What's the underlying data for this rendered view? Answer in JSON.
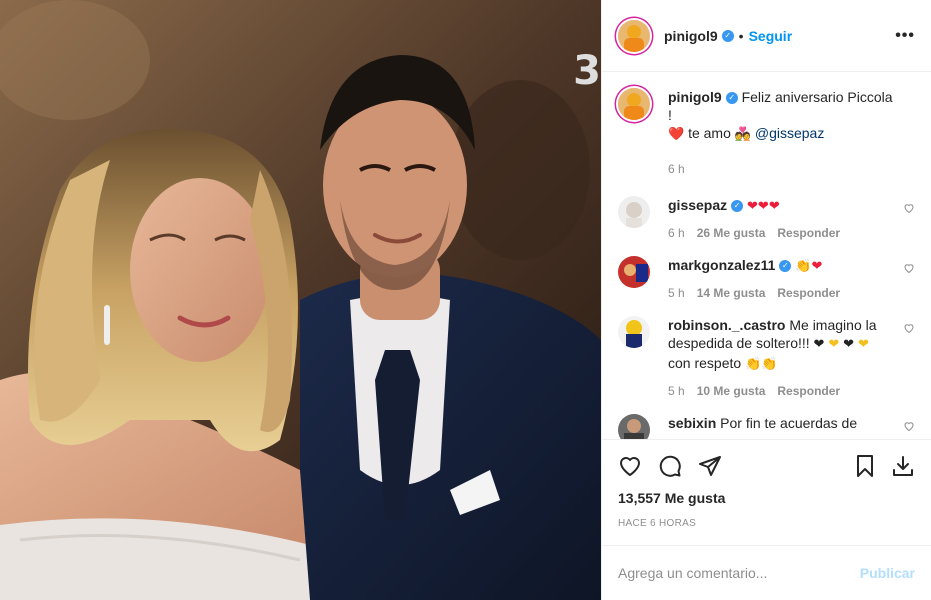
{
  "header": {
    "username": "pinigol9",
    "separator": "•",
    "follow_label": "Seguir",
    "more_label": "•••"
  },
  "caption": {
    "username": "pinigol9",
    "text_line1": "Feliz aniversario Piccola !",
    "heart": "❤️",
    "text_love": "te amo",
    "couple_emoji": "💑",
    "mention": "@gissepaz",
    "time": "6 h"
  },
  "comments": [
    {
      "username": "gissepaz",
      "verified": true,
      "emojis": "❤❤❤",
      "time": "6 h",
      "likes": "26 Me gusta",
      "reply": "Responder"
    },
    {
      "username": "markgonzalez11",
      "verified": true,
      "emojis_clap": "👏",
      "emojis_heart": "❤",
      "time": "5 h",
      "likes": "14 Me gusta",
      "reply": "Responder"
    },
    {
      "username": "robinson._.castro",
      "verified": false,
      "text": "Me imagino la despedida de soltero!!!",
      "heart_black": "❤",
      "heart_yellow": "❤",
      "text2": "con respeto",
      "hands": "👏👏",
      "time": "5 h",
      "likes": "10 Me gusta",
      "reply": "Responder"
    },
    {
      "username": "sebixin",
      "verified": false,
      "text": "Por fin te acuerdas de"
    }
  ],
  "actions": {
    "likes_count": "13,557 Me gusta",
    "time_ago": "Hace 6 horas"
  },
  "add_comment": {
    "placeholder": "Agrega un comentario...",
    "publish_label": "Publicar"
  },
  "colors": {
    "follow_blue": "#0095f6",
    "verified_blue": "#3897f0",
    "story_ring": "#d6249f",
    "heart_red": "#ed1c3a"
  },
  "icons": [
    "heart-icon",
    "comment-icon",
    "share-icon",
    "bookmark-icon",
    "download-icon",
    "verified-icon",
    "more-icon"
  ]
}
